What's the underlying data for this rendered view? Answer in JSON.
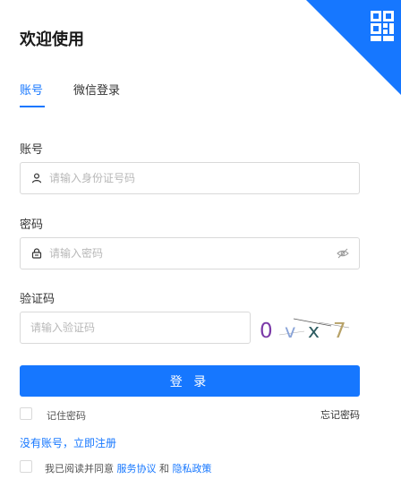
{
  "header": {
    "title": "欢迎使用"
  },
  "tabs": [
    {
      "label": "账号",
      "active": true
    },
    {
      "label": "微信登录",
      "active": false
    }
  ],
  "account": {
    "label": "账号",
    "placeholder": "请输入身份证号码",
    "icon": "user-icon"
  },
  "password": {
    "label": "密码",
    "placeholder": "请输入密码",
    "icon": "lock-icon",
    "toggle_icon": "eye-off-icon"
  },
  "captcha": {
    "label": "验证码",
    "placeholder": "请输入验证码",
    "code": [
      "0",
      "v",
      "x",
      "7"
    ]
  },
  "login_button": {
    "label": "登 录"
  },
  "remember": {
    "label": "记住密码",
    "checked": false
  },
  "forgot": {
    "label": "忘记密码"
  },
  "register": {
    "label": "没有账号，立即注册"
  },
  "agreement": {
    "prefix": "我已阅读并同意",
    "service": "服务协议",
    "and": "和",
    "privacy": "隐私政策",
    "checked": false
  },
  "colors": {
    "primary": "#1677ff",
    "border": "#d9d9d9",
    "placeholder": "#b8b8b8"
  }
}
